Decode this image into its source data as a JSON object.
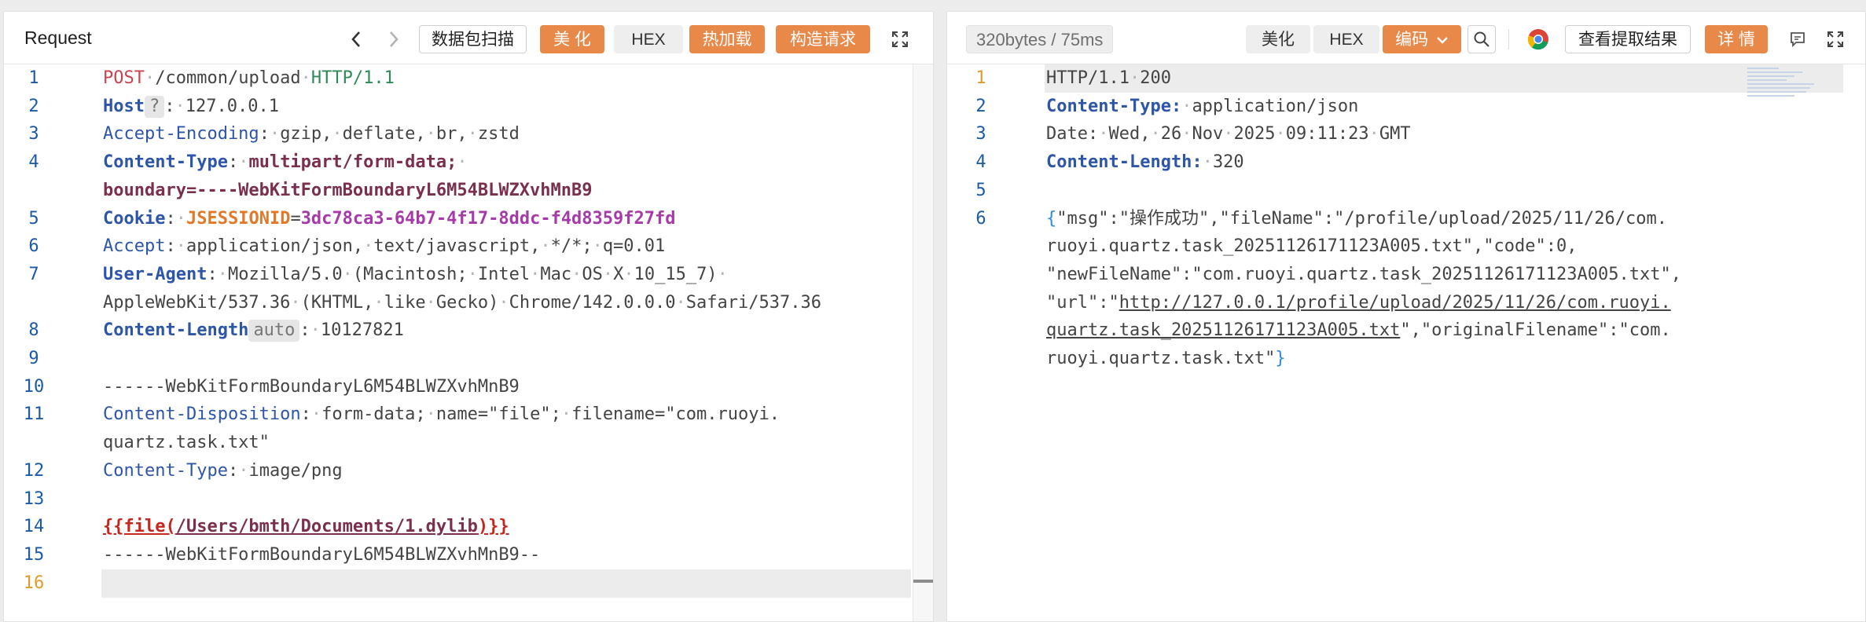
{
  "request_panel": {
    "title": "Request",
    "toolbar": {
      "back_icon": "chevron-left-icon",
      "forward_icon": "chevron-right-icon",
      "scan_label": "数据包扫描",
      "beautify_label": "美 化",
      "hex_label": "HEX",
      "hot_reload_label": "热加载",
      "construct_label": "构造请求",
      "expand_icon": "expand-icon"
    },
    "lines": [
      {
        "num": "1",
        "parts": [
          {
            "t": "POST",
            "c": "k-method"
          },
          {
            "t": "·",
            "c": "dot"
          },
          {
            "t": "/common/upload",
            "c": ""
          },
          {
            "t": "·",
            "c": "dot"
          },
          {
            "t": "HTTP/1.1",
            "c": "k-proto"
          }
        ]
      },
      {
        "num": "2",
        "parts": [
          {
            "t": "Host",
            "c": "k-hname-b"
          },
          {
            "t": "?",
            "c": "pill"
          },
          {
            "t": ":",
            "c": ""
          },
          {
            "t": "·",
            "c": "dot"
          },
          {
            "t": "127.0.0.1",
            "c": ""
          }
        ]
      },
      {
        "num": "3",
        "parts": [
          {
            "t": "Accept-Encoding",
            "c": "k-hname"
          },
          {
            "t": ":",
            "c": ""
          },
          {
            "t": "·",
            "c": "dot"
          },
          {
            "t": "gzip,",
            "c": ""
          },
          {
            "t": "·",
            "c": "dot"
          },
          {
            "t": "deflate,",
            "c": ""
          },
          {
            "t": "·",
            "c": "dot"
          },
          {
            "t": "br,",
            "c": ""
          },
          {
            "t": "·",
            "c": "dot"
          },
          {
            "t": "zstd",
            "c": ""
          }
        ]
      },
      {
        "num": "4",
        "parts": [
          {
            "t": "Content-Type",
            "c": "k-hname-b"
          },
          {
            "t": ":",
            "c": ""
          },
          {
            "t": "·",
            "c": "dot"
          },
          {
            "t": "multipart/form-data;",
            "c": "k-purple"
          },
          {
            "t": "·",
            "c": "dot"
          }
        ]
      },
      {
        "num": "",
        "parts": [
          {
            "t": "boundary=----WebKitFormBoundaryL6M54BLWZXvhMnB9",
            "c": "k-purple"
          }
        ]
      },
      {
        "num": "5",
        "parts": [
          {
            "t": "Cookie",
            "c": "k-hname-b"
          },
          {
            "t": ":",
            "c": ""
          },
          {
            "t": "·",
            "c": "dot"
          },
          {
            "t": "JSESSIONID",
            "c": "k-cookie-n"
          },
          {
            "t": "=",
            "c": ""
          },
          {
            "t": "3dc78ca3-64b7-4f17-8ddc-f4d8359f27fd",
            "c": "k-cookie-v"
          }
        ]
      },
      {
        "num": "6",
        "parts": [
          {
            "t": "Accept",
            "c": "k-hname"
          },
          {
            "t": ":",
            "c": ""
          },
          {
            "t": "·",
            "c": "dot"
          },
          {
            "t": "application/json,",
            "c": ""
          },
          {
            "t": "·",
            "c": "dot"
          },
          {
            "t": "text/javascript,",
            "c": ""
          },
          {
            "t": "·",
            "c": "dot"
          },
          {
            "t": "*/*;",
            "c": ""
          },
          {
            "t": "·",
            "c": "dot"
          },
          {
            "t": "q=0.01",
            "c": ""
          }
        ]
      },
      {
        "num": "7",
        "parts": [
          {
            "t": "User-Agent",
            "c": "k-hname-b"
          },
          {
            "t": ":",
            "c": ""
          },
          {
            "t": "·",
            "c": "dot"
          },
          {
            "t": "Mozilla/5.0",
            "c": ""
          },
          {
            "t": "·",
            "c": "dot"
          },
          {
            "t": "(Macintosh;",
            "c": ""
          },
          {
            "t": "·",
            "c": "dot"
          },
          {
            "t": "Intel",
            "c": ""
          },
          {
            "t": "·",
            "c": "dot"
          },
          {
            "t": "Mac",
            "c": ""
          },
          {
            "t": "·",
            "c": "dot"
          },
          {
            "t": "OS",
            "c": ""
          },
          {
            "t": "·",
            "c": "dot"
          },
          {
            "t": "X",
            "c": ""
          },
          {
            "t": "·",
            "c": "dot"
          },
          {
            "t": "10_15_7)",
            "c": ""
          },
          {
            "t": "·",
            "c": "dot"
          }
        ]
      },
      {
        "num": "",
        "parts": [
          {
            "t": "AppleWebKit/537.36",
            "c": ""
          },
          {
            "t": "·",
            "c": "dot"
          },
          {
            "t": "(KHTML,",
            "c": ""
          },
          {
            "t": "·",
            "c": "dot"
          },
          {
            "t": "like",
            "c": ""
          },
          {
            "t": "·",
            "c": "dot"
          },
          {
            "t": "Gecko)",
            "c": ""
          },
          {
            "t": "·",
            "c": "dot"
          },
          {
            "t": "Chrome/142.0.0.0",
            "c": ""
          },
          {
            "t": "·",
            "c": "dot"
          },
          {
            "t": "Safari/537.36",
            "c": ""
          }
        ]
      },
      {
        "num": "8",
        "parts": [
          {
            "t": "Content-Length",
            "c": "k-hname-b"
          },
          {
            "t": "auto",
            "c": "pill"
          },
          {
            "t": ":",
            "c": ""
          },
          {
            "t": "·",
            "c": "dot"
          },
          {
            "t": "10127821",
            "c": ""
          }
        ]
      },
      {
        "num": "9",
        "parts": []
      },
      {
        "num": "10",
        "parts": [
          {
            "t": "------WebKitFormBoundaryL6M54BLWZXvhMnB9",
            "c": ""
          }
        ]
      },
      {
        "num": "11",
        "parts": [
          {
            "t": "Content-Disposition",
            "c": "k-hname"
          },
          {
            "t": ":",
            "c": ""
          },
          {
            "t": "·",
            "c": "dot"
          },
          {
            "t": "form-data;",
            "c": ""
          },
          {
            "t": "·",
            "c": "dot"
          },
          {
            "t": "name=\"file\";",
            "c": ""
          },
          {
            "t": "·",
            "c": "dot"
          },
          {
            "t": "filename=\"com.ruoyi.",
            "c": ""
          }
        ]
      },
      {
        "num": "",
        "parts": [
          {
            "t": "quartz.task.txt\"",
            "c": ""
          }
        ]
      },
      {
        "num": "12",
        "parts": [
          {
            "t": "Content-Type",
            "c": "k-hname"
          },
          {
            "t": ":",
            "c": ""
          },
          {
            "t": "·",
            "c": "dot"
          },
          {
            "t": "image/png",
            "c": ""
          }
        ]
      },
      {
        "num": "13",
        "parts": []
      },
      {
        "num": "14",
        "parts": [
          {
            "t": "{{file(",
            "c": "k-tag"
          },
          {
            "t": "/Users/bmth/Documents/1.dylib",
            "c": "k-tagpath"
          },
          {
            "t": ")}}",
            "c": "k-tag"
          }
        ]
      },
      {
        "num": "15",
        "parts": [
          {
            "t": "------WebKitFormBoundaryL6M54BLWZXvhMnB9--",
            "c": ""
          }
        ]
      },
      {
        "num": "16",
        "parts": [],
        "active": true
      }
    ]
  },
  "response_panel": {
    "stats": "320bytes / 75ms",
    "toolbar": {
      "beautify_label": "美化",
      "hex_label": "HEX",
      "encoding_label": "编码",
      "encoding_icon": "chevron-down-icon",
      "search_icon": "search-icon",
      "chrome_icon": "chrome-icon",
      "view_extract_label": "查看提取结果",
      "details_label": "详 情",
      "comment_icon": "comment-icon",
      "expand_icon": "expand-icon"
    },
    "lines": [
      {
        "num": "1",
        "active": true,
        "parts": [
          {
            "t": "HTTP/1.1",
            "c": ""
          },
          {
            "t": "·",
            "c": "dot"
          },
          {
            "t": "200",
            "c": ""
          }
        ]
      },
      {
        "num": "2",
        "parts": [
          {
            "t": "Content-Type:",
            "c": "k-hname-b"
          },
          {
            "t": "·",
            "c": "dot"
          },
          {
            "t": "application/json",
            "c": ""
          }
        ]
      },
      {
        "num": "3",
        "parts": [
          {
            "t": "Date:",
            "c": ""
          },
          {
            "t": "·",
            "c": "dot"
          },
          {
            "t": "Wed,",
            "c": ""
          },
          {
            "t": "·",
            "c": "dot"
          },
          {
            "t": "26",
            "c": ""
          },
          {
            "t": "·",
            "c": "dot"
          },
          {
            "t": "Nov",
            "c": ""
          },
          {
            "t": "·",
            "c": "dot"
          },
          {
            "t": "2025",
            "c": ""
          },
          {
            "t": "·",
            "c": "dot"
          },
          {
            "t": "09:11:23",
            "c": ""
          },
          {
            "t": "·",
            "c": "dot"
          },
          {
            "t": "GMT",
            "c": ""
          }
        ]
      },
      {
        "num": "4",
        "parts": [
          {
            "t": "Content-Length:",
            "c": "k-hname-b"
          },
          {
            "t": "·",
            "c": "dot"
          },
          {
            "t": "320",
            "c": ""
          }
        ]
      },
      {
        "num": "5",
        "parts": []
      },
      {
        "num": "6",
        "parts": [
          {
            "t": "{",
            "c": "k-brace"
          },
          {
            "t": "\"msg\":\"操作成功\",\"fileName\":\"/profile/upload/2025/11/26/com.",
            "c": ""
          }
        ]
      },
      {
        "num": "",
        "parts": [
          {
            "t": "ruoyi.quartz.task_20251126171123A005.txt\",\"code\":0,",
            "c": ""
          }
        ]
      },
      {
        "num": "",
        "parts": [
          {
            "t": "\"newFileName\":\"com.ruoyi.quartz.task_20251126171123A005.txt\",",
            "c": ""
          }
        ]
      },
      {
        "num": "",
        "parts": [
          {
            "t": "\"url\":\"",
            "c": ""
          },
          {
            "t": "http://127.0.0.1/profile/upload/2025/11/26/com.ruoyi.",
            "c": "k-url"
          }
        ]
      },
      {
        "num": "",
        "parts": [
          {
            "t": "quartz.task_20251126171123A005.txt",
            "c": "k-url"
          },
          {
            "t": "\",\"originalFilename\":\"com.",
            "c": ""
          }
        ]
      },
      {
        "num": "",
        "parts": [
          {
            "t": "ruoyi.quartz.task.txt\"",
            "c": ""
          },
          {
            "t": "}",
            "c": "k-brace"
          }
        ]
      }
    ]
  }
}
